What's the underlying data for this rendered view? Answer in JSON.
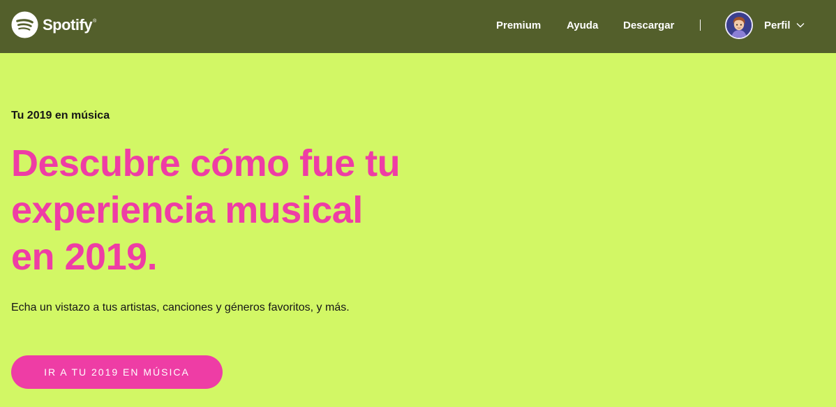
{
  "header": {
    "brand": "Spotify",
    "nav": {
      "premium": "Premium",
      "ayuda": "Ayuda",
      "descargar": "Descargar"
    },
    "profile_label": "Perfil",
    "icons": {
      "logo": "spotify-logo-icon",
      "avatar": "avatar-image",
      "chevron": "chevron-down-icon"
    }
  },
  "hero": {
    "eyebrow": "Tu 2019 en música",
    "headline_line1": "Descubre cómo fue tu",
    "headline_line2": "experiencia musical",
    "headline_line3": "en 2019.",
    "subtitle": "Echa un vistazo a tus artistas, canciones y géneros favoritos, y más.",
    "cta_label": "IR A TU 2019 EN MÚSICA"
  },
  "colors": {
    "header_bg": "#535f2b",
    "page_bg": "#d2f765",
    "accent_pink": "#ee3da5",
    "text_dark": "#161616",
    "text_light": "#ffffff"
  }
}
